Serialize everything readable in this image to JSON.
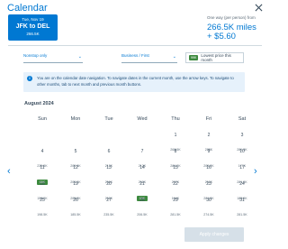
{
  "header": {
    "title": "Calendar"
  },
  "flight": {
    "date": "Tue, Nov 19",
    "route": "JFK to DEL",
    "price": "266.5K"
  },
  "summary": {
    "label": "One way (per person) from",
    "miles": "266.5K miles",
    "fee": "+ $5.60"
  },
  "filters": {
    "stops": "Nonstop only",
    "cabin": "Business / First",
    "lowest_badge": "99K",
    "lowest_label": "Lowest price this month"
  },
  "info": {
    "message": "You are on the calendar date navigation. To navigate dates in the current month, use the arrow keys. To navigate to other months, tab to next month and previous month buttons."
  },
  "calendar": {
    "month": "August 2024",
    "weekdays": [
      "Sun",
      "Mon",
      "Tue",
      "Wed",
      "Thu",
      "Fri",
      "Sat"
    ],
    "days": [
      {
        "day": "1",
        "price": "268.5K"
      },
      {
        "day": "2",
        "price": "288K"
      },
      {
        "day": "3",
        "price": "281.5K"
      },
      {
        "day": "4",
        "price": "235.5K"
      },
      {
        "day": "5",
        "price": "205.5K"
      },
      {
        "day": "6",
        "price": "212K"
      },
      {
        "day": "7",
        "price": "212K"
      },
      {
        "day": "8",
        "price": "281.5K"
      },
      {
        "day": "9",
        "price": "205.5K"
      },
      {
        "day": "10",
        "price": "177K"
      },
      {
        "day": "11",
        "price": "99K",
        "low": true
      },
      {
        "day": "12",
        "price": "205.5K"
      },
      {
        "day": "13",
        "price": "210K"
      },
      {
        "day": "14",
        "price": "212K"
      },
      {
        "day": "15",
        "price": "207K"
      },
      {
        "day": "16",
        "price": "212K"
      },
      {
        "day": "17",
        "price": "281.5K"
      },
      {
        "day": "18",
        "price": "150.5K"
      },
      {
        "day": "19",
        "price": "205.5K"
      },
      {
        "day": "20",
        "price": "212K"
      },
      {
        "day": "21",
        "price": "99K",
        "low": true
      },
      {
        "day": "22",
        "price": "164K"
      },
      {
        "day": "23",
        "price": "281.5K"
      },
      {
        "day": "24",
        "price": "185.5K"
      },
      {
        "day": "25",
        "price": "198.5K"
      },
      {
        "day": "26",
        "price": "185.5K"
      },
      {
        "day": "27",
        "price": "235.5K"
      },
      {
        "day": "28",
        "price": "206.5K"
      },
      {
        "day": "29",
        "price": "281.5K"
      },
      {
        "day": "30",
        "price": "274.5K"
      },
      {
        "day": "31",
        "price": "281.5K"
      }
    ]
  },
  "footer": {
    "apply": "Apply changes"
  },
  "colors": {
    "accent": "#0078d2",
    "low_price": "#3d8a3f",
    "info_bg": "#e6f1fb"
  },
  "icons": {
    "close": "close-icon",
    "info": "info-icon",
    "prev": "chevron-left-icon",
    "next": "chevron-right-icon",
    "dropdown": "chevron-down-icon"
  }
}
